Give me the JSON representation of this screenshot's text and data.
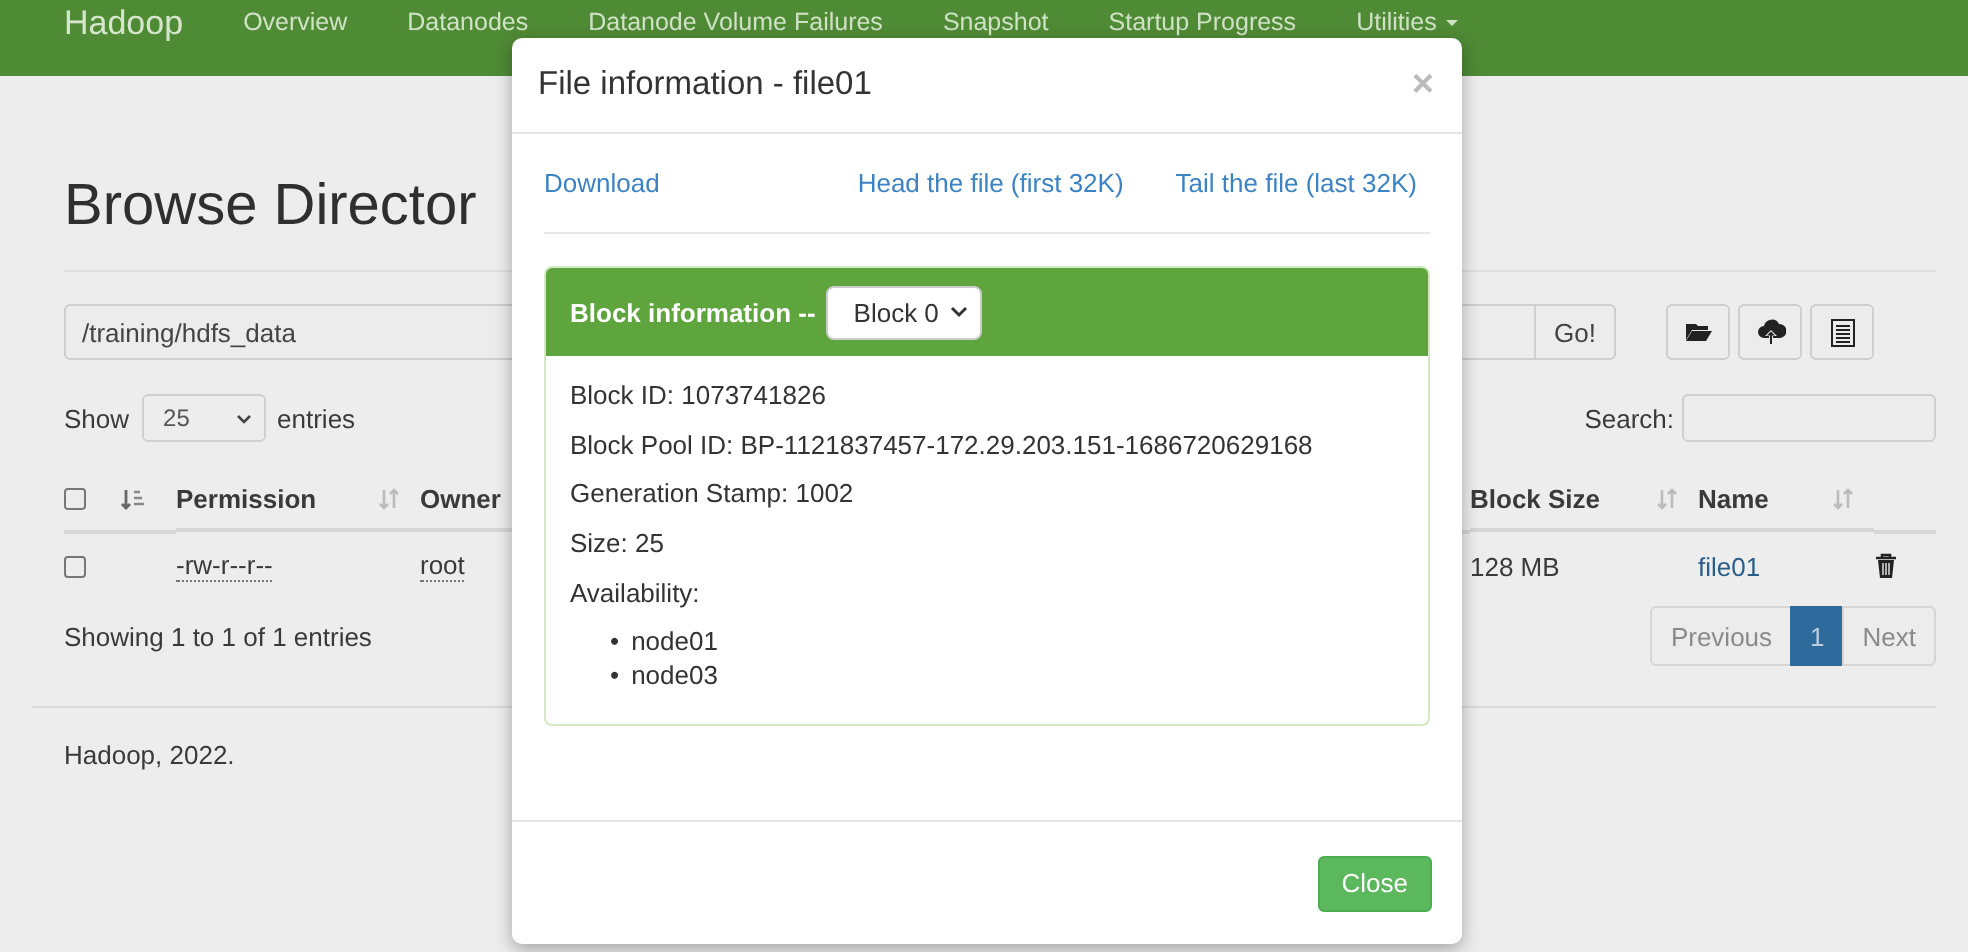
{
  "navbar": {
    "brand": "Hadoop",
    "items": [
      {
        "label": "Overview"
      },
      {
        "label": "Datanodes"
      },
      {
        "label": "Datanode Volume Failures"
      },
      {
        "label": "Snapshot"
      },
      {
        "label": "Startup Progress"
      },
      {
        "label": "Utilities",
        "caret": true
      }
    ]
  },
  "page": {
    "title": "Browse Director",
    "path": "/training/hdfs_data",
    "go_button": "Go!",
    "show_label": "Show",
    "page_size": "25",
    "entries_label": "entries",
    "search_label": "Search:",
    "table": {
      "select_all_checked": false,
      "columns": [
        {
          "label": "Permission"
        },
        {
          "label": "Owner"
        },
        {
          "label": "Block Size"
        },
        {
          "label": "Name"
        }
      ],
      "rows": [
        {
          "checked": false,
          "permission": "-rw-r--r--",
          "owner": "root",
          "block_size": "128 MB",
          "name": "file01"
        }
      ]
    },
    "info": "Showing 1 to 1 of 1 entries",
    "pagination": [
      {
        "label": "Previous",
        "selected": false
      },
      {
        "label": "1",
        "selected": true
      },
      {
        "label": "Next",
        "selected": false
      }
    ],
    "footer": "Hadoop, 2022."
  },
  "modal": {
    "title": "File information - file01",
    "close_icon": "×",
    "links": [
      "Download",
      "Head the file (first 32K)",
      "Tail the file (last 32K)"
    ],
    "panel_title": "Block information --",
    "block_select": "Block 0",
    "details": [
      "Block ID: 1073741826",
      "Block Pool ID: BP-1121837457-172.29.203.151-1686720629168",
      "Generation Stamp: 1002",
      "Size: 25",
      "Availability:"
    ],
    "bullet": "•",
    "nodes": [
      "node01",
      "node03"
    ],
    "close_button": "Close"
  }
}
